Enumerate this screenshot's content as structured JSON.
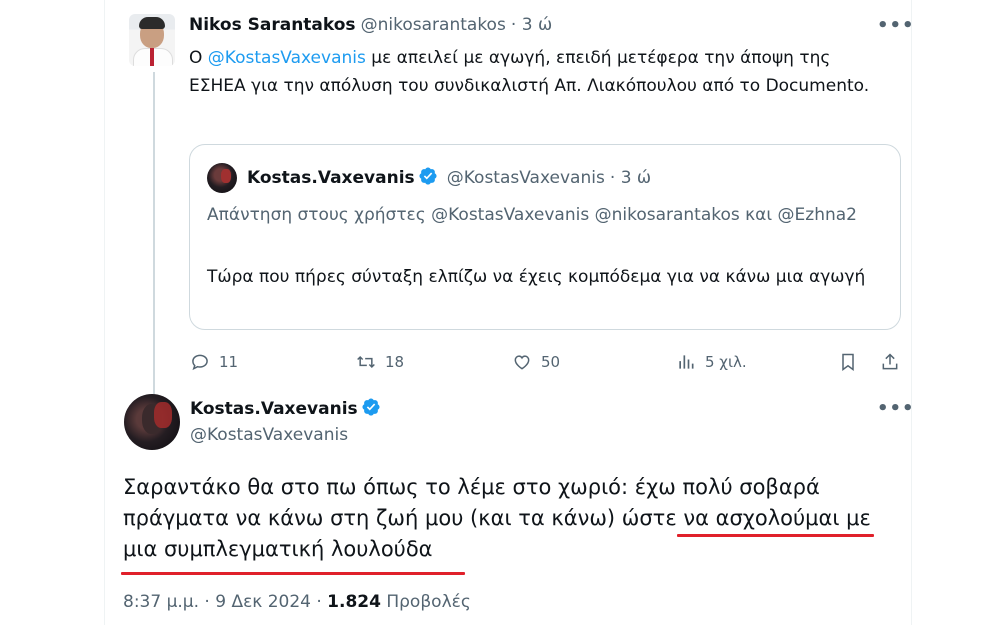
{
  "tweet1": {
    "author_name": "Nikos Sarantakos",
    "author_handle": "@nikosarantakos",
    "time": "· 3 ώ",
    "more": "•••",
    "text_prefix": "Ο ",
    "mention": "@KostasVaxevanis",
    "text_suffix": " με απειλεί με αγωγή, επειδή μετέφερα την άποψη της ΕΣΗΕΑ για την απόλυση του συνδικαλιστή Απ. Λιακόπουλου από το Documento."
  },
  "quote": {
    "author_name": "Kostas.Vaxevanis",
    "author_handle": "@KostasVaxevanis",
    "time": "· 3 ώ",
    "reply_to": "Απάντηση στους χρήστες @KostasVaxevanis @nikosarantakos και @Ezhna2",
    "text": "Τώρα που πήρες σύνταξη ελπίζω να έχεις κομπόδεμα για να κάνω μια αγωγή"
  },
  "actions": {
    "replies": "11",
    "retweets": "18",
    "likes": "50",
    "views": "5 χιλ."
  },
  "tweet2": {
    "author_name": "Kostas.Vaxevanis",
    "author_handle": "@KostasVaxevanis",
    "more": "•••",
    "text": "Σαραντάκο θα στο πω όπως το λέμε στο χωριό: έχω πολύ σοβαρά πράγματα να κάνω στη ζωή μου (και τα κάνω) ώστε να ασχολούμαι με μια συμπλεγματική λουλούδα",
    "time": "8:37 μ.μ. · 9 Δεκ 2024 · ",
    "views_count": "1.824",
    "views_label": " Προβολές"
  },
  "colors": {
    "accent": "#1d9bf0",
    "underline": "#e0202a",
    "secondary_text": "#536471"
  },
  "icons": [
    "reply-icon",
    "retweet-icon",
    "like-icon",
    "views-icon",
    "bookmark-icon",
    "share-icon",
    "verified-badge-icon"
  ]
}
